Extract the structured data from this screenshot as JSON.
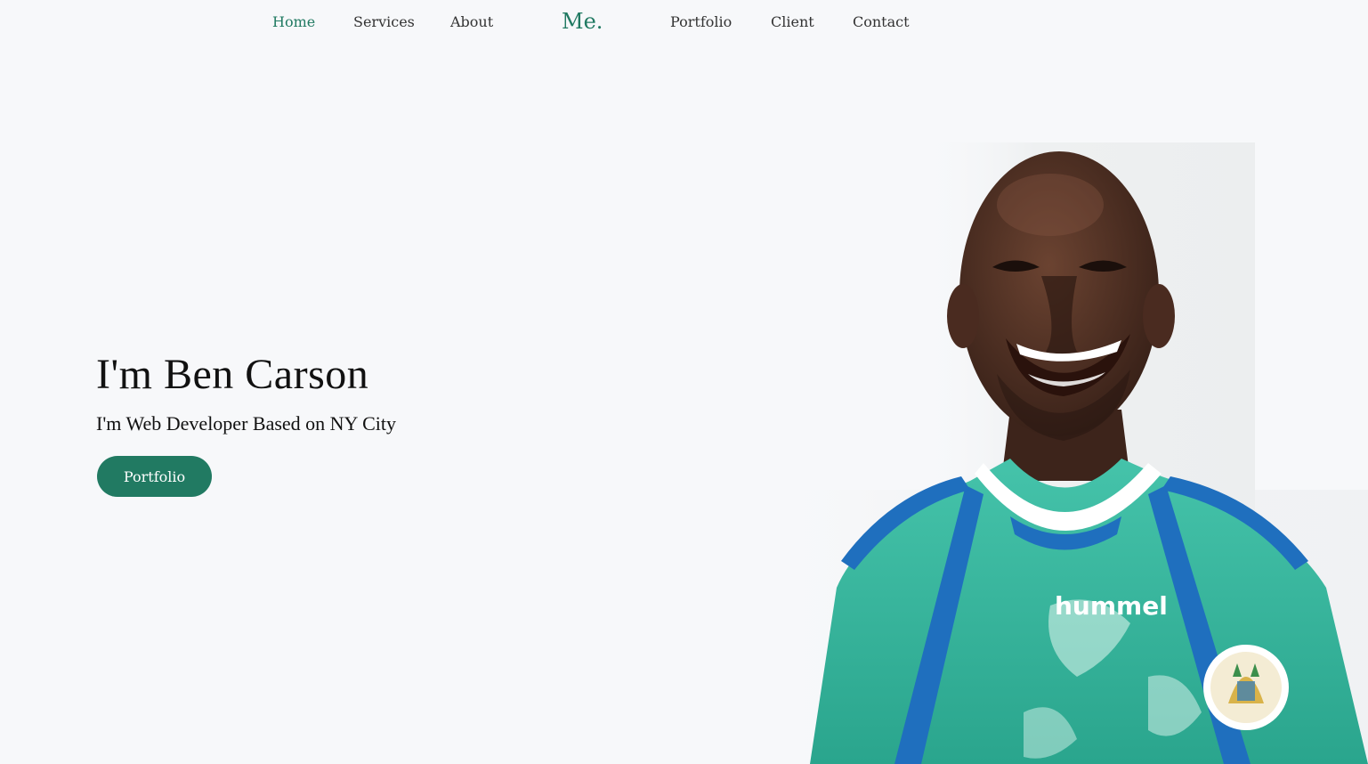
{
  "nav": {
    "items": [
      {
        "label": "Home",
        "active": true
      },
      {
        "label": "Services",
        "active": false
      },
      {
        "label": "About",
        "active": false
      },
      {
        "label": "Portfolio",
        "active": false
      },
      {
        "label": "Client",
        "active": false
      },
      {
        "label": "Contact",
        "active": false
      }
    ],
    "logo": "Me."
  },
  "hero": {
    "title": "I'm Ben Carson",
    "subtitle": "I'm Web Developer Based on NY City",
    "button_label": "Portfolio"
  },
  "portrait": {
    "jersey_brand": "hummel",
    "icon": "portrait-photo"
  },
  "colors": {
    "accent": "#217a62",
    "background": "#f7f8fa",
    "text": "#111111",
    "nav_text": "#333333",
    "jersey": "#3bb79f",
    "jersey_stripe": "#1f6fbe"
  }
}
